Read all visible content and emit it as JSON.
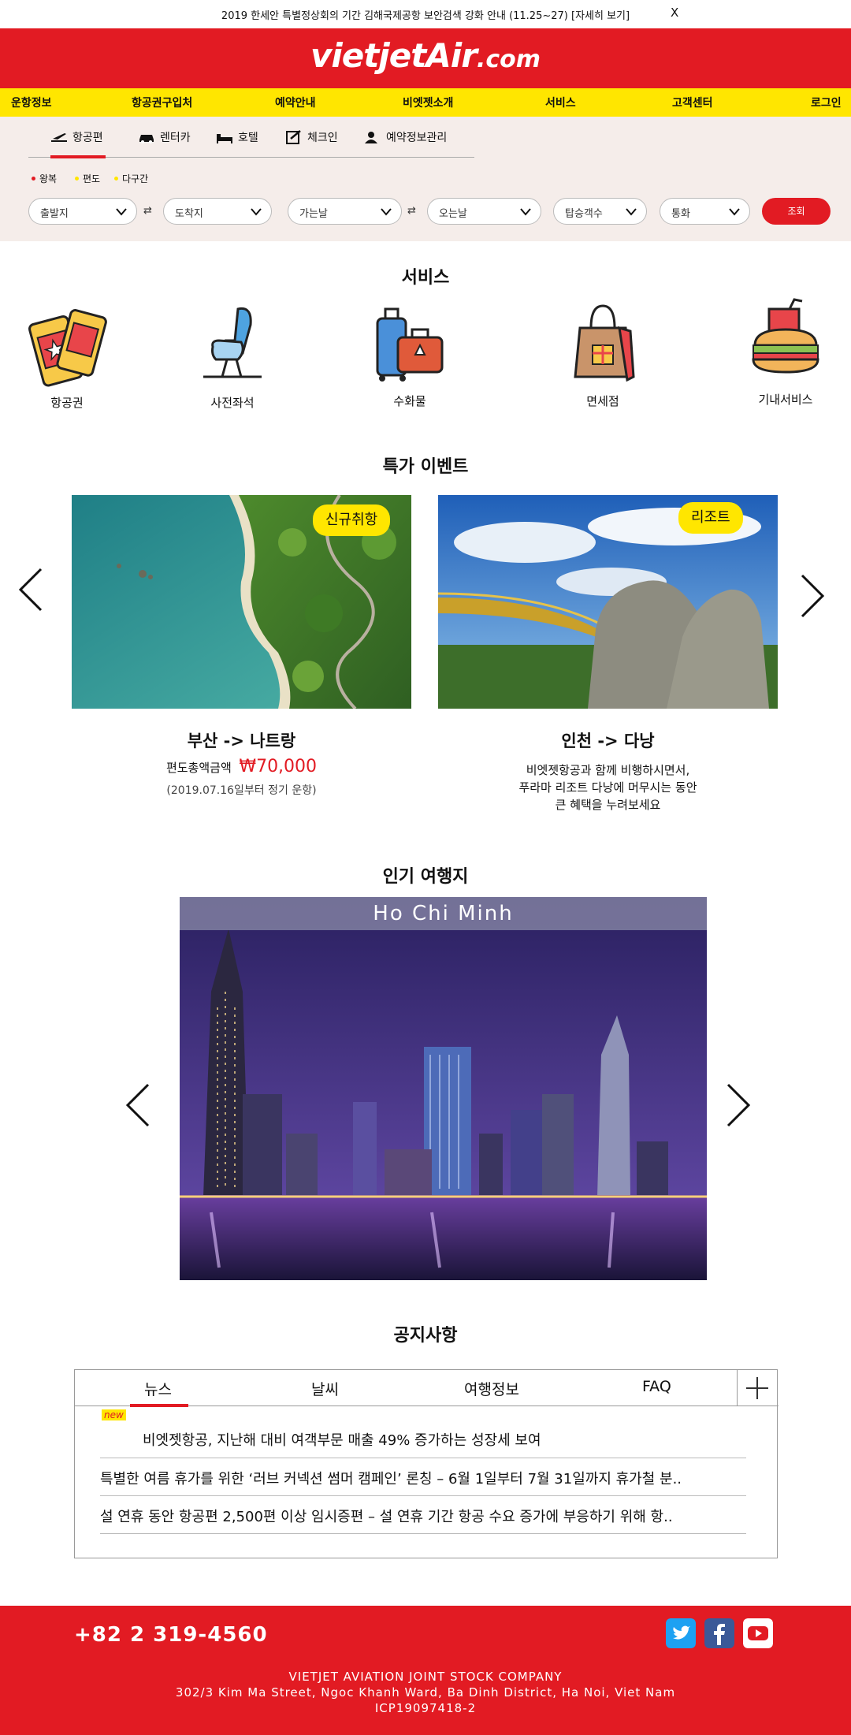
{
  "notice": {
    "text": "2019 한세안 특별정상회의 기간 김해국제공항 보안검색 강화 안내 (11.25~27) [자세히 보기]",
    "close": "X"
  },
  "header": {
    "logo_main": "vietjetAir",
    "logo_domain": ".com"
  },
  "nav": {
    "items": [
      "운항정보",
      "항공권구입처",
      "예약안내",
      "비엣젯소개",
      "서비스",
      "고객센터",
      "로그인"
    ]
  },
  "search": {
    "tabs": [
      "항공편",
      "렌터카",
      "호텔",
      "체크인",
      "예약정보관리"
    ],
    "trip_types": [
      "왕복",
      "편도",
      "다구간"
    ],
    "fields": {
      "origin": "출발지",
      "destination": "도착지",
      "depart_date": "가는날",
      "return_date": "오는날",
      "passengers": "탑승객수",
      "currency": "통화"
    },
    "search_button": "조회"
  },
  "services": {
    "title": "서비스",
    "items": [
      {
        "label": "항공권",
        "icon": "ticket-icon"
      },
      {
        "label": "사전좌석",
        "icon": "seat-icon"
      },
      {
        "label": "수화물",
        "icon": "luggage-icon"
      },
      {
        "label": "면세점",
        "icon": "shopping-bag-icon"
      },
      {
        "label": "기내서비스",
        "icon": "meal-icon"
      }
    ]
  },
  "events": {
    "title": "특가 이벤트",
    "cards": [
      {
        "badge": "신규취항",
        "title": "부산 -> 나트랑",
        "price_label": "편도총액금액",
        "price": "₩70,000",
        "note": "(2019.07.16일부터 정기 운항)"
      },
      {
        "badge": "리조트",
        "title": "인천 -> 다낭",
        "desc_lines": [
          "비엣젯항공과 함께 비행하시면서,",
          "푸라마 리조트 다낭에 머무시는 동안",
          "큰 혜택을 누려보세요"
        ]
      }
    ]
  },
  "destinations": {
    "title": "인기 여행지",
    "current": "Ho Chi Minh"
  },
  "notices": {
    "title": "공지사항",
    "tabs": [
      "뉴스",
      "날씨",
      "여행정보",
      "FAQ"
    ],
    "new_badge": "new",
    "items": [
      "비엣젯항공, 지난해 대비 여객부문 매출 49% 증가하는 성장세 보여",
      "특별한 여름 휴가를 위한 ‘러브 커넥션 썸머 캠페인’ 론칭 – 6월 1일부터 7월 31일까지 휴가철 분..",
      "설 연휴 동안 항공편 2,500편 이상 임시증편 – 설 연휴 기간 항공 수요 증가에 부응하기 위해 항.."
    ]
  },
  "footer": {
    "phone": "+82 2 319-4560",
    "company": "VIETJET AVIATION JOINT STOCK COMPANY",
    "address": "302/3 Kim Ma Street, Ngoc Khanh Ward, Ba Dinh District, Ha Noi, Viet Nam",
    "license": "ICP19097418-2"
  },
  "colors": {
    "brand_red": "#e21b23",
    "brand_yellow": "#ffe600",
    "panel_bg": "#f5edea"
  }
}
